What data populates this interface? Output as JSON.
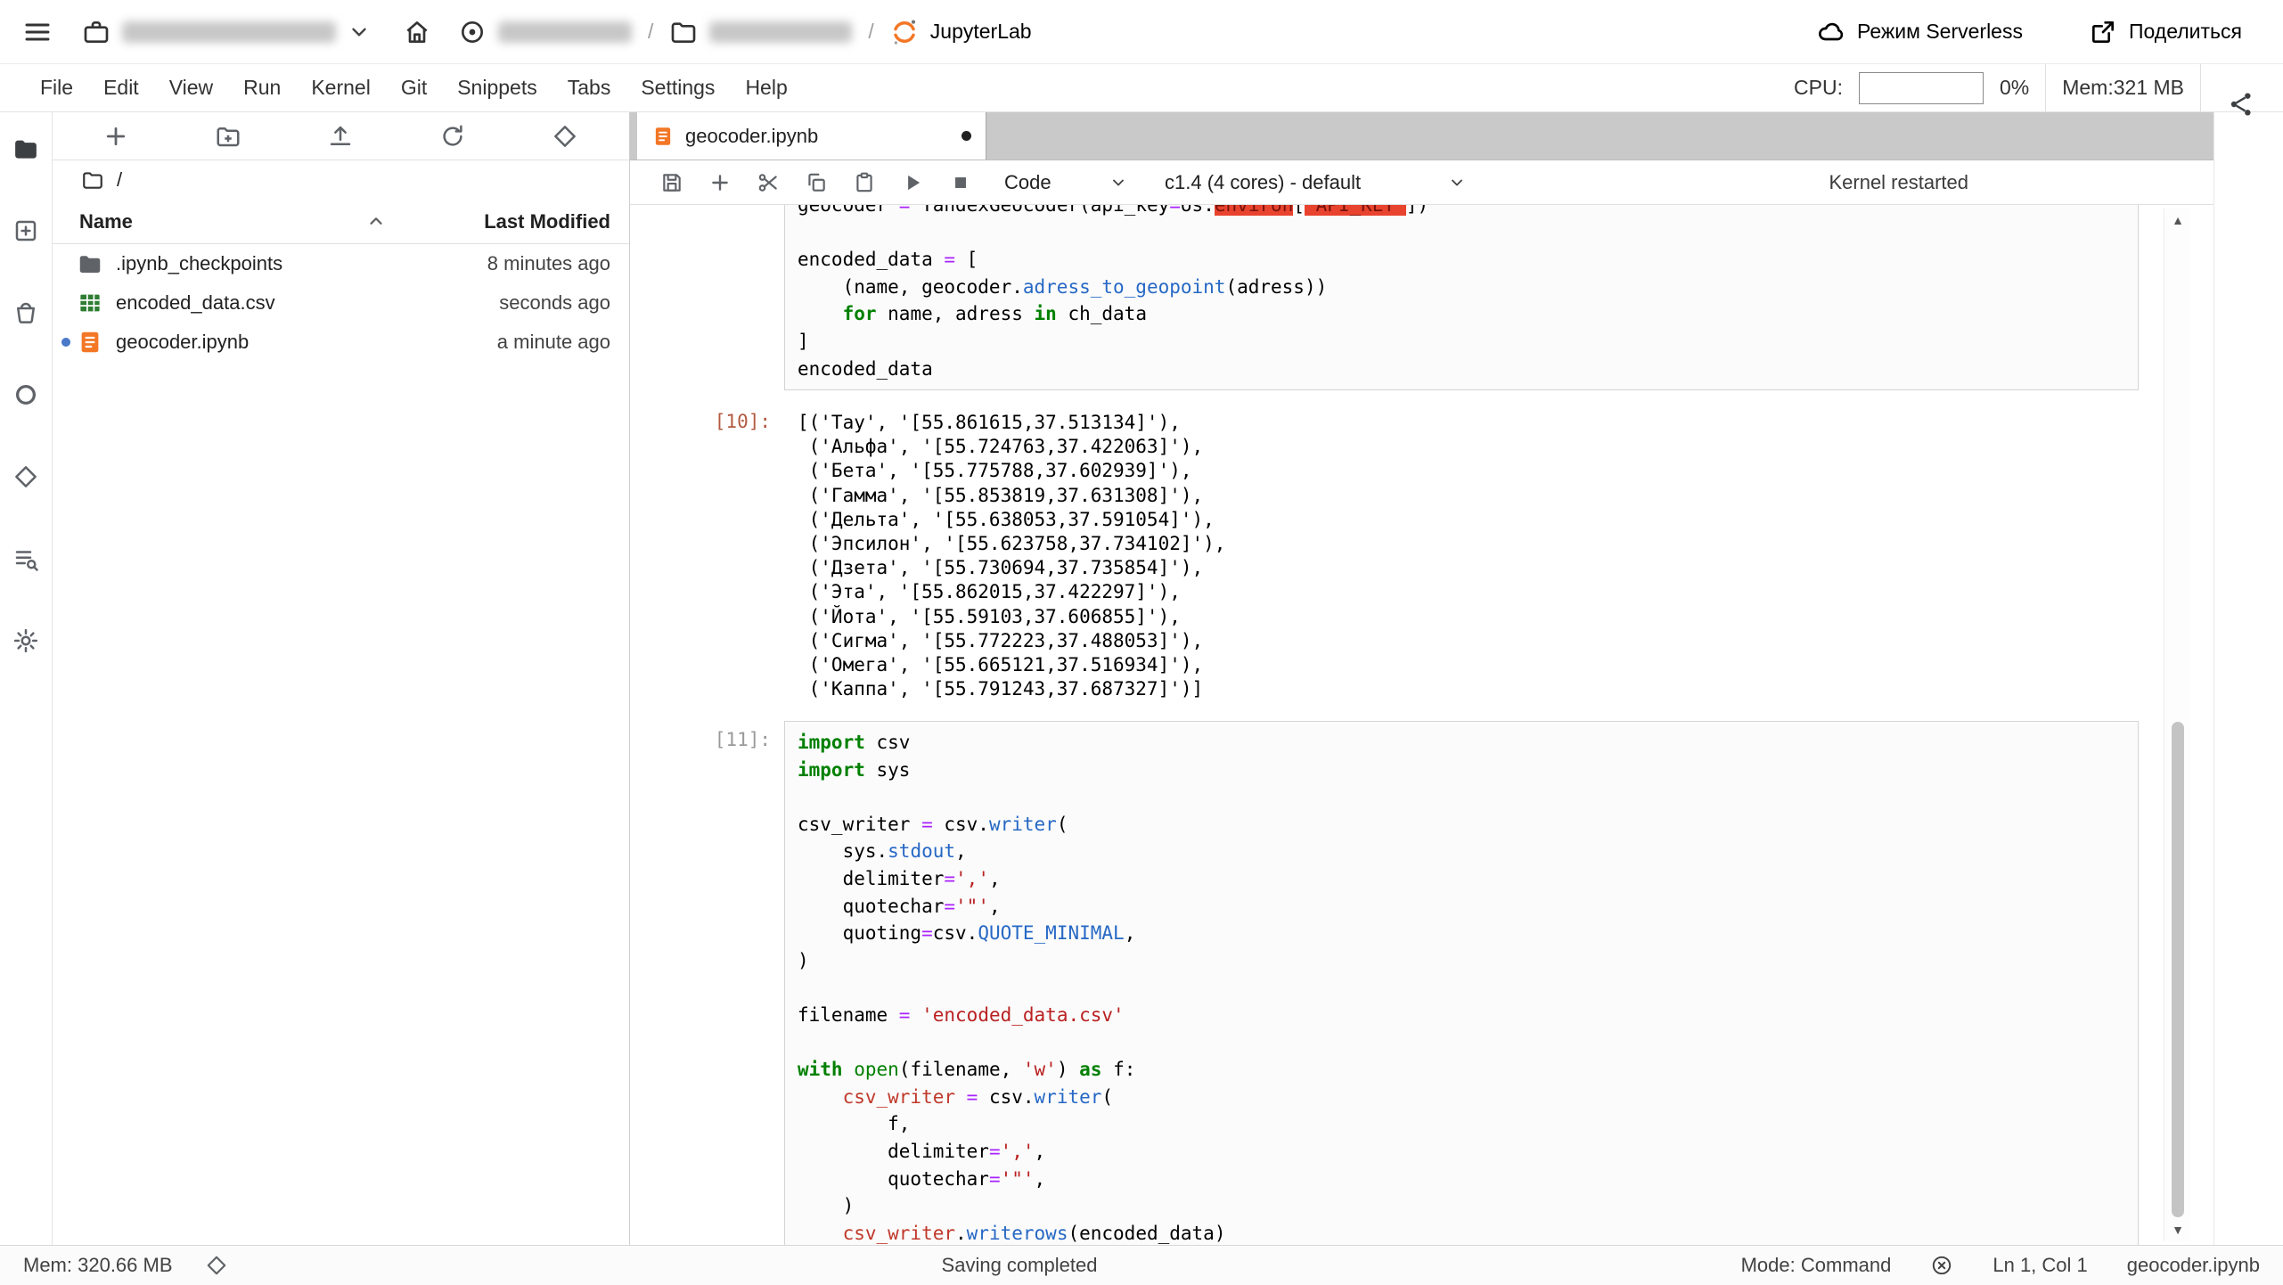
{
  "topbar": {
    "jupyterlab": "JupyterLab",
    "serverless": "Режим Serverless",
    "share": "Поделиться",
    "sep1": "/",
    "sep2": "/"
  },
  "menubar": {
    "items": [
      "File",
      "Edit",
      "View",
      "Run",
      "Kernel",
      "Git",
      "Snippets",
      "Tabs",
      "Settings",
      "Help"
    ],
    "cpu_label": "CPU:",
    "cpu_percent": "0%",
    "mem": "Mem:321 MB"
  },
  "sidebar": {
    "icons": [
      "file-browser",
      "new-resource",
      "storage-bucket",
      "sessions",
      "datasphere",
      "table-of-contents",
      "settings"
    ]
  },
  "filebrowser": {
    "path": "/",
    "toolbar_icons": [
      "new-launcher",
      "new-folder",
      "upload",
      "refresh",
      "git-clone"
    ],
    "name_header": "Name",
    "modified_header": "Last Modified",
    "files": [
      {
        "name": ".ipynb_checkpoints",
        "modified": "8 minutes ago",
        "type": "folder",
        "marked": false
      },
      {
        "name": "encoded_data.csv",
        "modified": "seconds ago",
        "type": "csv",
        "marked": false
      },
      {
        "name": "geocoder.ipynb",
        "modified": "a minute ago",
        "type": "notebook",
        "marked": true
      }
    ]
  },
  "tabbar": {
    "active_tab": "geocoder.ipynb"
  },
  "nbtoolbar": {
    "icons": [
      "save",
      "add-cell",
      "cut",
      "copy",
      "paste",
      "run",
      "stop"
    ],
    "cell_type": "Code",
    "kernel": "c1.4 (4 cores) - default",
    "status": "Kernel restarted"
  },
  "notebook": {
    "cell_top": {
      "lines": [
        [
          [
            "n",
            "geocoder "
          ],
          [
            "o",
            "="
          ],
          [
            "n",
            " YandexGeocoder(api_key"
          ],
          [
            "o",
            "="
          ],
          [
            "n",
            "os."
          ],
          [
            "err",
            "environ"
          ],
          [
            "n",
            "["
          ],
          [
            "err",
            "'API_KEY'"
          ],
          [
            "n",
            "])"
          ]
        ],
        [],
        [
          [
            "n",
            "encoded_data "
          ],
          [
            "o",
            "="
          ],
          [
            "n",
            " ["
          ]
        ],
        [
          [
            "n",
            "    (name, geocoder."
          ],
          [
            "p",
            "adress_to_geopoint"
          ],
          [
            "n",
            "(adress))"
          ]
        ],
        [
          [
            "n",
            "    "
          ],
          [
            "k",
            "for"
          ],
          [
            "n",
            " name, adress "
          ],
          [
            "k",
            "in"
          ],
          [
            "n",
            " ch_data"
          ]
        ],
        [
          [
            "n",
            "]"
          ]
        ],
        [
          [
            "n",
            "encoded_data"
          ]
        ]
      ]
    },
    "out10": {
      "prompt": "[10]:",
      "lines": [
        "[('Тау', '[55.861615,37.513134]'),",
        " ('Альфа', '[55.724763,37.422063]'),",
        " ('Бета', '[55.775788,37.602939]'),",
        " ('Гамма', '[55.853819,37.631308]'),",
        " ('Дельта', '[55.638053,37.591054]'),",
        " ('Эпсилон', '[55.623758,37.734102]'),",
        " ('Дзета', '[55.730694,37.735854]'),",
        " ('Эта', '[55.862015,37.422297]'),",
        " ('Йота', '[55.59103,37.606855]'),",
        " ('Сигма', '[55.772223,37.488053]'),",
        " ('Омега', '[55.665121,37.516934]'),",
        " ('Каппа', '[55.791243,37.687327]')]"
      ]
    },
    "cell11": {
      "prompt": "[11]:",
      "lines": [
        [
          [
            "k",
            "import"
          ],
          [
            "n",
            " csv"
          ]
        ],
        [
          [
            "k",
            "import"
          ],
          [
            "n",
            " sys"
          ]
        ],
        [],
        [
          [
            "n",
            "csv_writer "
          ],
          [
            "o",
            "="
          ],
          [
            "n",
            " csv."
          ],
          [
            "p",
            "writer"
          ],
          [
            "n",
            "("
          ]
        ],
        [
          [
            "n",
            "    sys."
          ],
          [
            "p",
            "stdout"
          ],
          [
            "n",
            ","
          ]
        ],
        [
          [
            "n",
            "    delimiter"
          ],
          [
            "o",
            "="
          ],
          [
            "s",
            "','"
          ],
          [
            "n",
            ","
          ]
        ],
        [
          [
            "n",
            "    quotechar"
          ],
          [
            "o",
            "="
          ],
          [
            "s",
            "'\"'"
          ],
          [
            "n",
            ","
          ]
        ],
        [
          [
            "n",
            "    quoting"
          ],
          [
            "o",
            "="
          ],
          [
            "n",
            "csv."
          ],
          [
            "p",
            "QUOTE_MINIMAL"
          ],
          [
            "n",
            ","
          ]
        ],
        [
          [
            "n",
            ")"
          ]
        ],
        [],
        [
          [
            "n",
            "filename "
          ],
          [
            "o",
            "="
          ],
          [
            "n",
            " "
          ],
          [
            "s",
            "'encoded_data.csv'"
          ]
        ],
        [],
        [
          [
            "k",
            "with"
          ],
          [
            "n",
            " "
          ],
          [
            "b",
            "open"
          ],
          [
            "n",
            "(filename, "
          ],
          [
            "s",
            "'w'"
          ],
          [
            "n",
            ") "
          ],
          [
            "k",
            "as"
          ],
          [
            "n",
            " f:"
          ]
        ],
        [
          [
            "n",
            "    "
          ],
          [
            "hl",
            "csv_writer"
          ],
          [
            "n",
            " "
          ],
          [
            "o",
            "="
          ],
          [
            "n",
            " csv."
          ],
          [
            "p",
            "writer"
          ],
          [
            "n",
            "("
          ]
        ],
        [
          [
            "n",
            "        f,"
          ]
        ],
        [
          [
            "n",
            "        delimiter"
          ],
          [
            "o",
            "="
          ],
          [
            "s",
            "','"
          ],
          [
            "n",
            ","
          ]
        ],
        [
          [
            "n",
            "        quotechar"
          ],
          [
            "o",
            "="
          ],
          [
            "s",
            "'\"'"
          ],
          [
            "n",
            ","
          ]
        ],
        [
          [
            "n",
            "    )"
          ]
        ],
        [
          [
            "n",
            "    "
          ],
          [
            "hl",
            "csv_writer"
          ],
          [
            "n",
            "."
          ],
          [
            "p",
            "writerows"
          ],
          [
            "n",
            "(encoded_data)"
          ]
        ]
      ]
    }
  },
  "statusbar": {
    "mem": "Mem: 320.66 MB",
    "message": "Saving completed",
    "mode": "Mode: Command",
    "cursor": "Ln 1, Col 1",
    "file": "geocoder.ipynb"
  },
  "colors": {
    "notebook_orange": "#f37726",
    "csv_green": "#2e7d32",
    "keyword_green": "#008000",
    "string_red": "#ba2121",
    "operator_purple": "#aa22ff",
    "method_blue": "#2668c5",
    "tabbar_gray": "#c9c9c9"
  }
}
